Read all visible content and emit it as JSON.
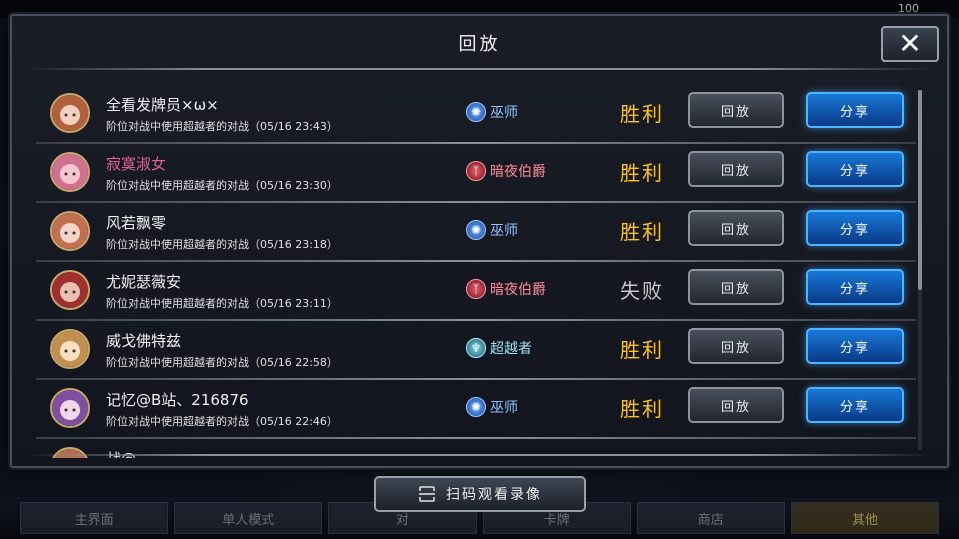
{
  "dialog": {
    "title": "回放",
    "close_label": "✕"
  },
  "replay_list": [
    {
      "name": "全看发牌员×ω×",
      "name_color": "#f0f0f0",
      "description": "阶位对战中使用超越者的对战（05/16 23:43）",
      "opponent_class": "巫师",
      "class_icon": "wizard-icon",
      "result": "胜利",
      "replay_label": "回放",
      "share_label": "分享"
    },
    {
      "name": "寂寞淑女",
      "name_color": "#e0609a",
      "description": "阶位对战中使用超越者的对战（05/16 23:30）",
      "opponent_class": "暗夜伯爵",
      "class_icon": "vampire-icon",
      "result": "胜利",
      "replay_label": "回放",
      "share_label": "分享"
    },
    {
      "name": "风若飘零",
      "name_color": "#f0f0f0",
      "description": "阶位对战中使用超越者的对战（05/16 23:18）",
      "opponent_class": "巫师",
      "class_icon": "wizard-icon",
      "result": "胜利",
      "replay_label": "回放",
      "share_label": "分享"
    },
    {
      "name": "尤妮瑟薇安",
      "name_color": "#f0f0f0",
      "description": "阶位对战中使用超越者的对战（05/16 23:11）",
      "opponent_class": "暗夜伯爵",
      "class_icon": "vampire-icon",
      "result": "失败",
      "replay_label": "回放",
      "share_label": "分享"
    },
    {
      "name": "威戈佛特兹",
      "name_color": "#f0f0f0",
      "description": "阶位对战中使用超越者的对战（05/16 22:58）",
      "opponent_class": "超越者",
      "class_icon": "transcendent-icon",
      "result": "胜利",
      "replay_label": "回放",
      "share_label": "分享"
    },
    {
      "name": "记忆@B站、216876",
      "name_color": "#f0f0f0",
      "description": "阶位对战中使用超越者的对战（05/16 22:46）",
      "opponent_class": "巫师",
      "class_icon": "wizard-icon",
      "result": "胜利",
      "replay_label": "回放",
      "share_label": "分享"
    },
    {
      "name": "战@",
      "partial": true
    }
  ],
  "scan_button": {
    "label": "扫码观看录像",
    "icon": "qr-scan-icon"
  },
  "background": {
    "top_stat": "100",
    "tabs": [
      "主界面",
      "单人模式",
      "对",
      "卡牌",
      "商店",
      "其他"
    ]
  },
  "colors": {
    "win": "#ffc21a",
    "lose": "#c8c8c8",
    "share_accent": "#1778d8"
  }
}
